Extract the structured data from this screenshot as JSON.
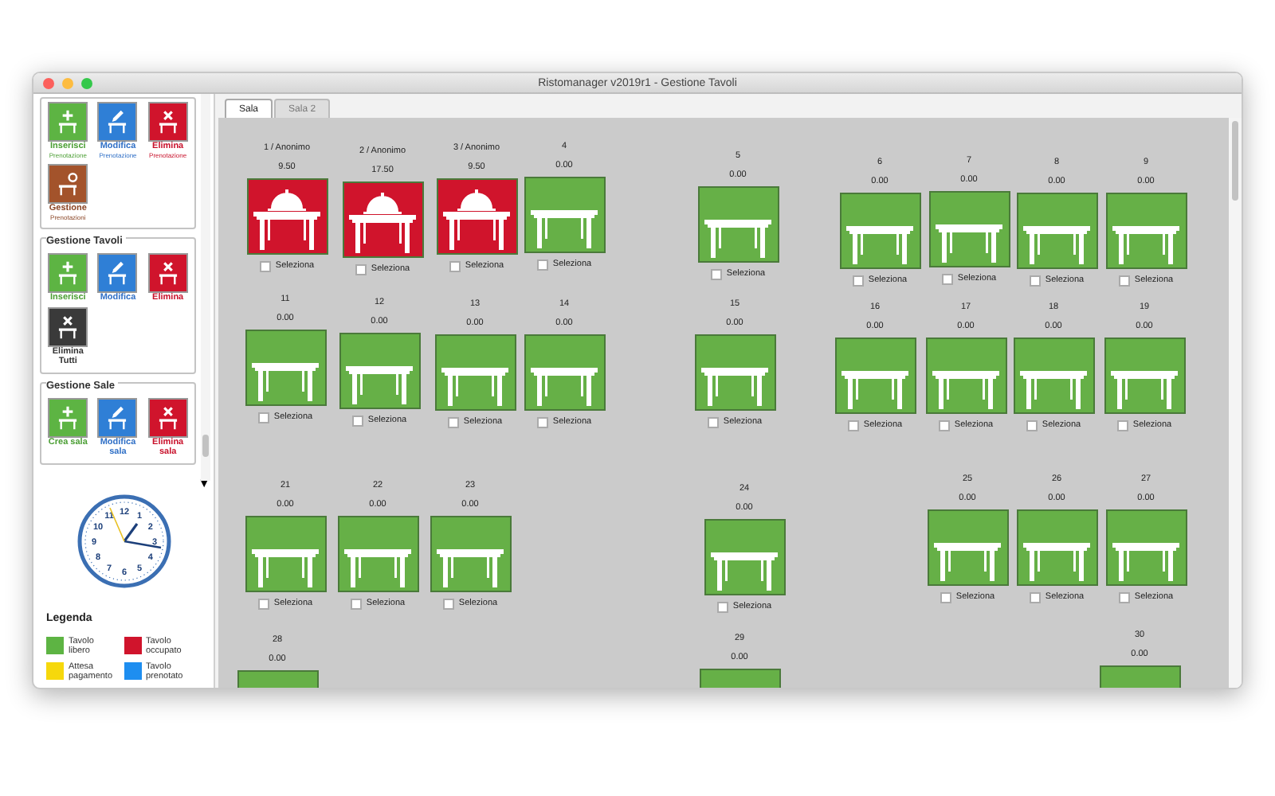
{
  "window": {
    "title": "Ristomanager v2019r1 - Gestione Tavoli"
  },
  "sidebar": {
    "sections": [
      {
        "buttons": [
          {
            "kind": "insert",
            "label": "Inserisci",
            "sublabel": "Prenotazione"
          },
          {
            "kind": "edit",
            "label": "Modifica",
            "sublabel": "Prenotazione"
          },
          {
            "kind": "delete",
            "label": "Elimina",
            "sublabel": "Prenotazione"
          },
          {
            "kind": "manage",
            "label": "Gestione",
            "sublabel": "Prenotazioni"
          }
        ]
      },
      {
        "title": "Gestione Tavoli",
        "buttons": [
          {
            "kind": "insert",
            "label": "Inserisci"
          },
          {
            "kind": "edit",
            "label": "Modifica"
          },
          {
            "kind": "delete",
            "label": "Elimina"
          },
          {
            "kind": "delete_all",
            "label": "Elimina Tutti"
          }
        ]
      },
      {
        "title": "Gestione Sale",
        "buttons": [
          {
            "kind": "insert",
            "label": "Crea sala"
          },
          {
            "kind": "edit",
            "label": "Modifica sala"
          },
          {
            "kind": "delete",
            "label": "Elimina sala"
          }
        ]
      }
    ]
  },
  "sidebar_scroll_arrow": "▼",
  "clock": {
    "numerals": [
      "11",
      "12",
      "1",
      "10",
      "2",
      "9",
      "3",
      "8",
      "4",
      "7",
      "6",
      "5"
    ]
  },
  "legend": {
    "title": "Legenda",
    "items": [
      {
        "label": "Tavolo libero",
        "color": "#5db443"
      },
      {
        "label": "Tavolo occupato",
        "color": "#d0142c"
      },
      {
        "label": "Attesa pagamento",
        "color": "#f6d80c"
      },
      {
        "label": "Tavolo prenotato",
        "color": "#1e8ef0"
      }
    ]
  },
  "tabs": [
    {
      "label": "Sala",
      "selected": true
    },
    {
      "label": "Sala 2",
      "selected": false
    }
  ],
  "tables": [
    {
      "label": "1 / Anonimo",
      "amount": "9.50",
      "occupied": true,
      "checked": false,
      "checkbox_label": "Seleziona"
    },
    {
      "label": "2 / Anonimo",
      "amount": "17.50",
      "occupied": true,
      "checked": false,
      "checkbox_label": "Seleziona"
    },
    {
      "label": "3 / Anonimo",
      "amount": "9.50",
      "occupied": true,
      "checked": false,
      "checkbox_label": "Seleziona"
    },
    {
      "label": "4",
      "amount": "0.00",
      "occupied": false,
      "checked": false,
      "checkbox_label": "Seleziona"
    },
    {
      "label": "5",
      "amount": "0.00",
      "occupied": false,
      "checked": false,
      "checkbox_label": "Seleziona"
    },
    {
      "label": "6",
      "amount": "0.00",
      "occupied": false,
      "checked": false,
      "checkbox_label": "Seleziona"
    },
    {
      "label": "7",
      "amount": "0.00",
      "occupied": false,
      "checked": false,
      "checkbox_label": "Seleziona"
    },
    {
      "label": "8",
      "amount": "0.00",
      "occupied": false,
      "checked": false,
      "checkbox_label": "Seleziona"
    },
    {
      "label": "9",
      "amount": "0.00",
      "occupied": false,
      "checked": false,
      "checkbox_label": "Seleziona"
    },
    {
      "label": "11",
      "amount": "0.00",
      "occupied": false,
      "checked": false,
      "checkbox_label": "Seleziona"
    },
    {
      "label": "12",
      "amount": "0.00",
      "occupied": false,
      "checked": false,
      "checkbox_label": "Seleziona"
    },
    {
      "label": "13",
      "amount": "0.00",
      "occupied": false,
      "checked": false,
      "checkbox_label": "Seleziona"
    },
    {
      "label": "14",
      "amount": "0.00",
      "occupied": false,
      "checked": false,
      "checkbox_label": "Seleziona"
    },
    {
      "label": "15",
      "amount": "0.00",
      "occupied": false,
      "checked": false,
      "checkbox_label": "Seleziona"
    },
    {
      "label": "16",
      "amount": "0.00",
      "occupied": false,
      "checked": false,
      "checkbox_label": "Seleziona"
    },
    {
      "label": "17",
      "amount": "0.00",
      "occupied": false,
      "checked": false,
      "checkbox_label": "Seleziona"
    },
    {
      "label": "18",
      "amount": "0.00",
      "occupied": false,
      "checked": false,
      "checkbox_label": "Seleziona"
    },
    {
      "label": "19",
      "amount": "0.00",
      "occupied": false,
      "checked": false,
      "checkbox_label": "Seleziona"
    },
    {
      "label": "21",
      "amount": "0.00",
      "occupied": false,
      "checked": false,
      "checkbox_label": "Seleziona"
    },
    {
      "label": "22",
      "amount": "0.00",
      "occupied": false,
      "checked": false,
      "checkbox_label": "Seleziona"
    },
    {
      "label": "23",
      "amount": "0.00",
      "occupied": false,
      "checked": false,
      "checkbox_label": "Seleziona"
    },
    {
      "label": "24",
      "amount": "0.00",
      "occupied": false,
      "checked": false,
      "checkbox_label": "Seleziona"
    },
    {
      "label": "25",
      "amount": "0.00",
      "occupied": false,
      "checked": false,
      "checkbox_label": "Seleziona"
    },
    {
      "label": "26",
      "amount": "0.00",
      "occupied": false,
      "checked": false,
      "checkbox_label": "Seleziona"
    },
    {
      "label": "27",
      "amount": "0.00",
      "occupied": false,
      "checked": false,
      "checkbox_label": "Seleziona"
    },
    {
      "label": "28",
      "amount": "0.00",
      "occupied": false
    },
    {
      "label": "29",
      "amount": "0.00",
      "occupied": false
    },
    {
      "label": "30",
      "amount": "0.00",
      "occupied": false
    }
  ]
}
